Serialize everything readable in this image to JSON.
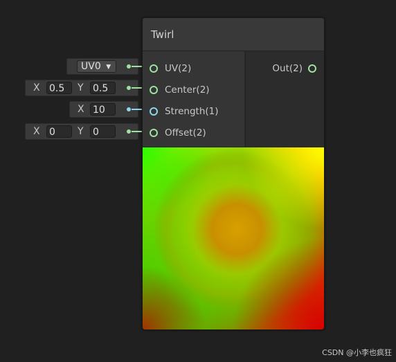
{
  "node": {
    "title": "Twirl",
    "inputs": [
      {
        "label": "UV(2)"
      },
      {
        "label": "Center(2)"
      },
      {
        "label": "Strength(1)"
      },
      {
        "label": "Offset(2)"
      }
    ],
    "outputs": [
      {
        "label": "Out(2)"
      }
    ]
  },
  "fields": {
    "uv": {
      "selected": "UV0",
      "arrow": "▼"
    },
    "center": {
      "x_label": "X",
      "x": "0.5",
      "y_label": "Y",
      "y": "0.5"
    },
    "strength": {
      "x_label": "X",
      "x": "10"
    },
    "offset": {
      "x_label": "X",
      "x": "0",
      "y_label": "Y",
      "y": "0"
    }
  },
  "colors": {
    "vector_port": "#9fe29f",
    "float_port": "#8ed6ee"
  },
  "watermark": "CSDN @小李也疯狂"
}
